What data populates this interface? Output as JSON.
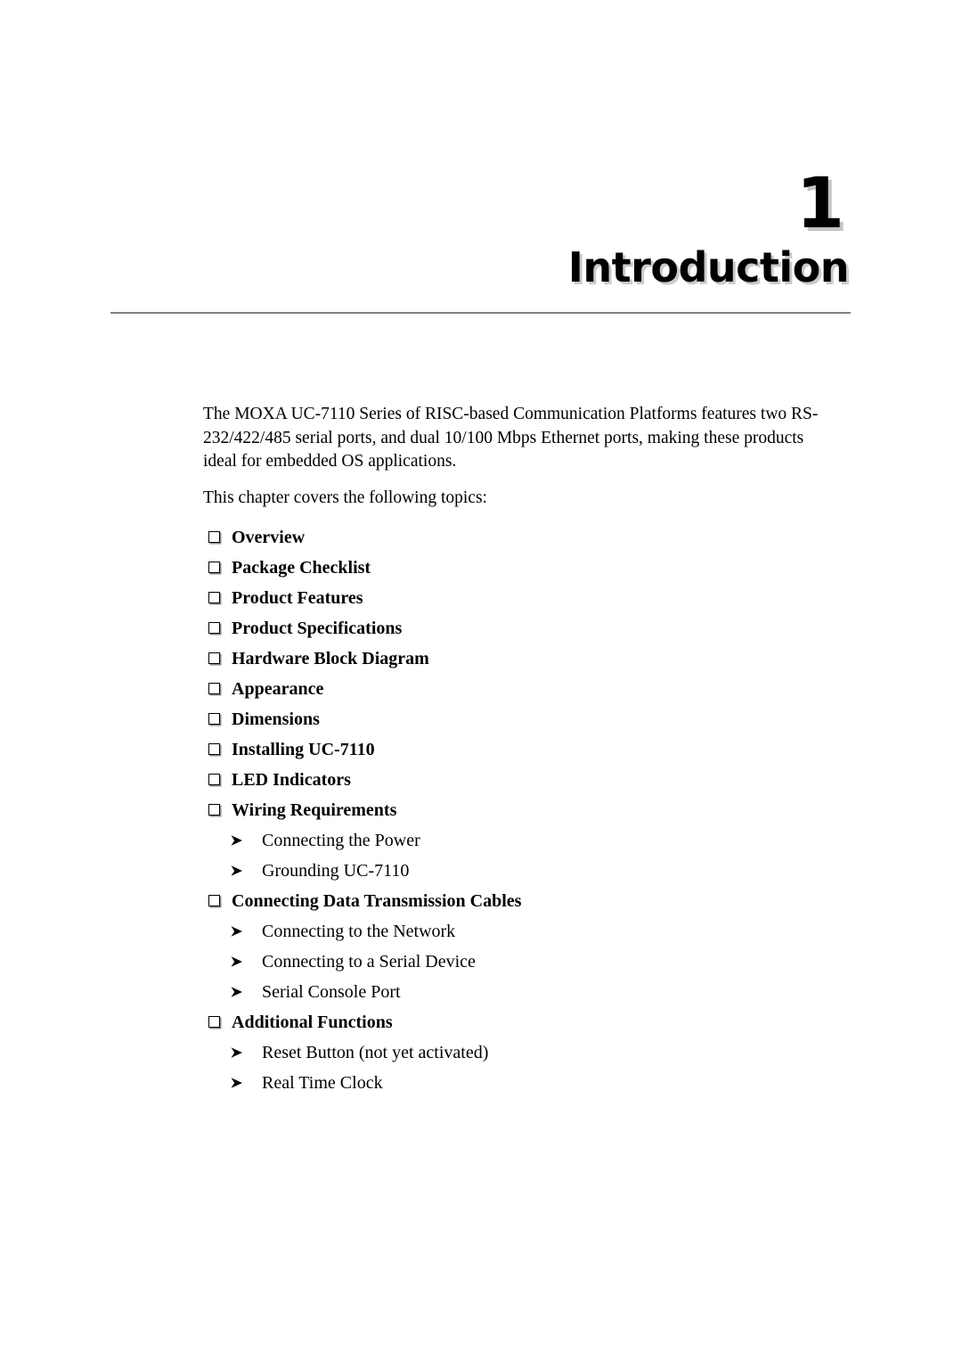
{
  "document": {
    "chapter_number": "1",
    "chapter_title": "Introduction"
  },
  "intro": {
    "paragraph_1": "The MOXA UC-7110 Series of RISC-based Communication Platforms features two RS-232/422/485 serial ports, and dual 10/100 Mbps Ethernet ports, making these products ideal for embedded OS applications.",
    "paragraph_2": "This chapter covers the following topics:"
  },
  "topics": [
    {
      "level": 1,
      "bullet": "box-bullet-icon",
      "label": "Overview"
    },
    {
      "level": 1,
      "bullet": "box-bullet-icon",
      "label": "Package Checklist"
    },
    {
      "level": 1,
      "bullet": "box-bullet-icon",
      "label": "Product Features"
    },
    {
      "level": 1,
      "bullet": "box-bullet-icon",
      "label": "Product Specifications"
    },
    {
      "level": 1,
      "bullet": "box-bullet-icon",
      "label": "Hardware Block Diagram"
    },
    {
      "level": 1,
      "bullet": "box-bullet-icon",
      "label": "Appearance"
    },
    {
      "level": 1,
      "bullet": "box-bullet-icon",
      "label": "Dimensions"
    },
    {
      "level": 1,
      "bullet": "box-bullet-icon",
      "label": "Installing UC-7110"
    },
    {
      "level": 1,
      "bullet": "box-bullet-icon",
      "label": "LED Indicators"
    },
    {
      "level": 1,
      "bullet": "box-bullet-icon",
      "label": "Wiring Requirements"
    },
    {
      "level": 2,
      "bullet": "arrow-bullet-icon",
      "label": "Connecting the Power"
    },
    {
      "level": 2,
      "bullet": "arrow-bullet-icon",
      "label": "Grounding UC-7110"
    },
    {
      "level": 1,
      "bullet": "box-bullet-icon",
      "label": "Connecting Data Transmission Cables"
    },
    {
      "level": 2,
      "bullet": "arrow-bullet-icon",
      "label": "Connecting to the Network"
    },
    {
      "level": 2,
      "bullet": "arrow-bullet-icon",
      "label": "Connecting to a Serial Device"
    },
    {
      "level": 2,
      "bullet": "arrow-bullet-icon",
      "label": "Serial Console Port"
    },
    {
      "level": 1,
      "bullet": "box-bullet-icon",
      "label": "Additional Functions"
    },
    {
      "level": 2,
      "bullet": "arrow-bullet-icon",
      "label": "Reset Button (not yet activated)"
    },
    {
      "level": 2,
      "bullet": "arrow-bullet-icon",
      "label": "Real Time Clock"
    }
  ],
  "style": {
    "rule_color": "#808080",
    "text_color": "#000000",
    "shadow_color": "#969696"
  }
}
